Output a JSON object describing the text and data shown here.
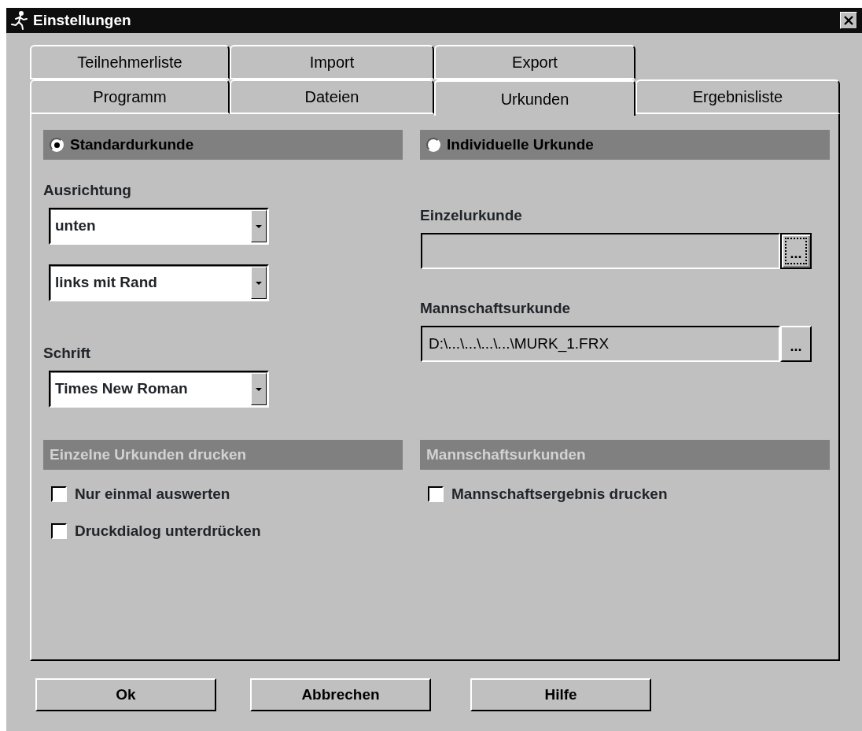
{
  "window": {
    "title": "Einstellungen"
  },
  "tab_rows": [
    [
      {
        "label": "Teilnehmerliste",
        "selected": false
      },
      {
        "label": "Import",
        "selected": false
      },
      {
        "label": "Export",
        "selected": false
      }
    ],
    [
      {
        "label": "Programm",
        "selected": false
      },
      {
        "label": "Dateien",
        "selected": false
      },
      {
        "label": "Urkunden",
        "selected": true
      },
      {
        "label": "Ergebnisliste",
        "selected": false
      }
    ]
  ],
  "standard": {
    "radio": {
      "label": "Standardurkunde",
      "selected": true
    },
    "groups": [
      {
        "label": "Ausrichtung",
        "dropdowns": [
          "unten",
          "links mit Rand"
        ]
      },
      {
        "label": "Schrift",
        "dropdowns": [
          "Times New Roman"
        ]
      }
    ]
  },
  "individual": {
    "radio": {
      "label": "Individuelle Urkunde",
      "selected": false
    },
    "files": [
      {
        "label": "Einzelurkunde",
        "button_label": "...",
        "focused": true
      },
      {
        "label": "Mannschaftsurkunde",
        "value": "D:\\...\\...\\...\\...\\MURK_1.FRX",
        "button_label": "...",
        "focused": false
      }
    ]
  },
  "print_sections": [
    {
      "title": "Einzelne Urkunden drucken",
      "disabled": true,
      "options": [
        {
          "label": "Nur einmal auswerten",
          "checked": false
        },
        {
          "label": "Druckdialog unterdrücken",
          "checked": false
        }
      ]
    },
    {
      "title": "Mannschaftsurkunden",
      "disabled": true,
      "options": [
        {
          "label": "Mannschaftsergebnis drucken",
          "checked": false
        }
      ]
    }
  ],
  "buttons": [
    "Ok",
    "Abbrechen",
    "Hilfe"
  ]
}
